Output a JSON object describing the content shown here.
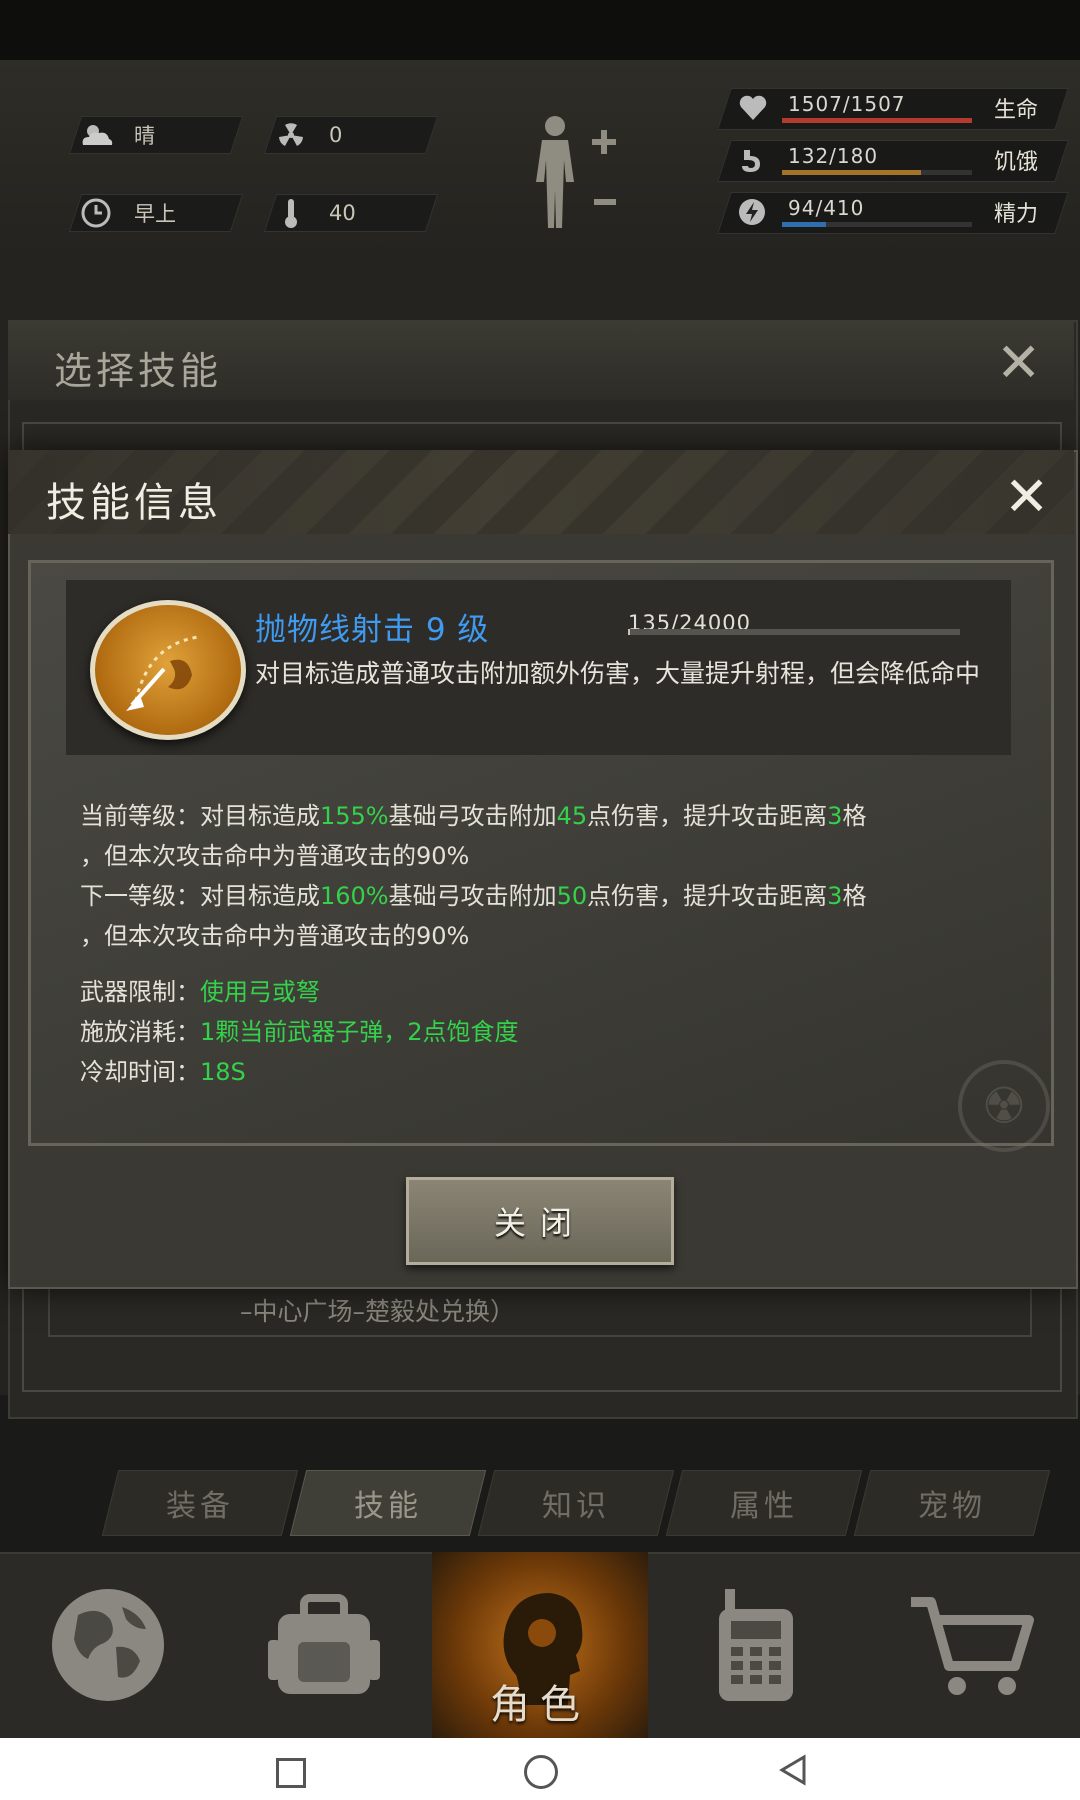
{
  "hud": {
    "weather": "晴",
    "radiation": "0",
    "time_of_day": "早上",
    "temperature": "40",
    "hp": {
      "text": "1507/1507",
      "label": "生命",
      "fraction": 1.0,
      "color": "#b23a2e"
    },
    "hunger": {
      "text": "132/180",
      "label": "饥饿",
      "fraction": 0.733,
      "color": "#a4732a"
    },
    "energy": {
      "text": "94/410",
      "label": "精力",
      "fraction": 0.229,
      "color": "#2f6fb0"
    }
  },
  "select_panel": {
    "title": "选择技能",
    "close_glyph": "✕"
  },
  "info": {
    "title": "技能信息",
    "close_glyph": "✕",
    "skill": {
      "name": "抛物线射击 9 级",
      "xp_text": "135/24000",
      "xp_fraction": 0.0056,
      "description": "对目标造成普通攻击附加额外伤害，大量提升射程，但会降低命中"
    },
    "current": {
      "prefix": "当前等级：对目标造成",
      "pct": "155%",
      "mid": "基础弓攻击附加",
      "dmg": "45",
      "mid2": "点伤害，提升攻击距离",
      "range": "3",
      "suffix": "格",
      "line2": "，但本次攻击命中为普通攻击的90%"
    },
    "next": {
      "prefix": "下一等级：对目标造成",
      "pct": "160%",
      "mid": "基础弓攻击附加",
      "dmg": "50",
      "mid2": "点伤害，提升攻击距离",
      "range": "3",
      "suffix": "格",
      "line2": "，但本次攻击命中为普通攻击的90%"
    },
    "weapon_label": "武器限制：",
    "weapon_value": "使用弓或弩",
    "cost_label": "施放消耗：",
    "cost_value": "1颗当前武器子弹，2点饱食度",
    "cooldown_label": "冷却时间：",
    "cooldown_value": "18S",
    "close_button": "关闭"
  },
  "behind_text": "–中心广场–楚毅处兑换）",
  "tabs": [
    {
      "label": "装备"
    },
    {
      "label": "技能"
    },
    {
      "label": "知识"
    },
    {
      "label": "属性"
    },
    {
      "label": "宠物"
    }
  ],
  "active_tab": "技能",
  "bottom_nav": {
    "items": [
      "globe-icon",
      "backpack-icon",
      "character-icon",
      "radio-icon",
      "cart-icon"
    ],
    "active_label": "角色"
  },
  "colors": {
    "accent_blue": "#3f9af0",
    "green": "#34d14a"
  }
}
